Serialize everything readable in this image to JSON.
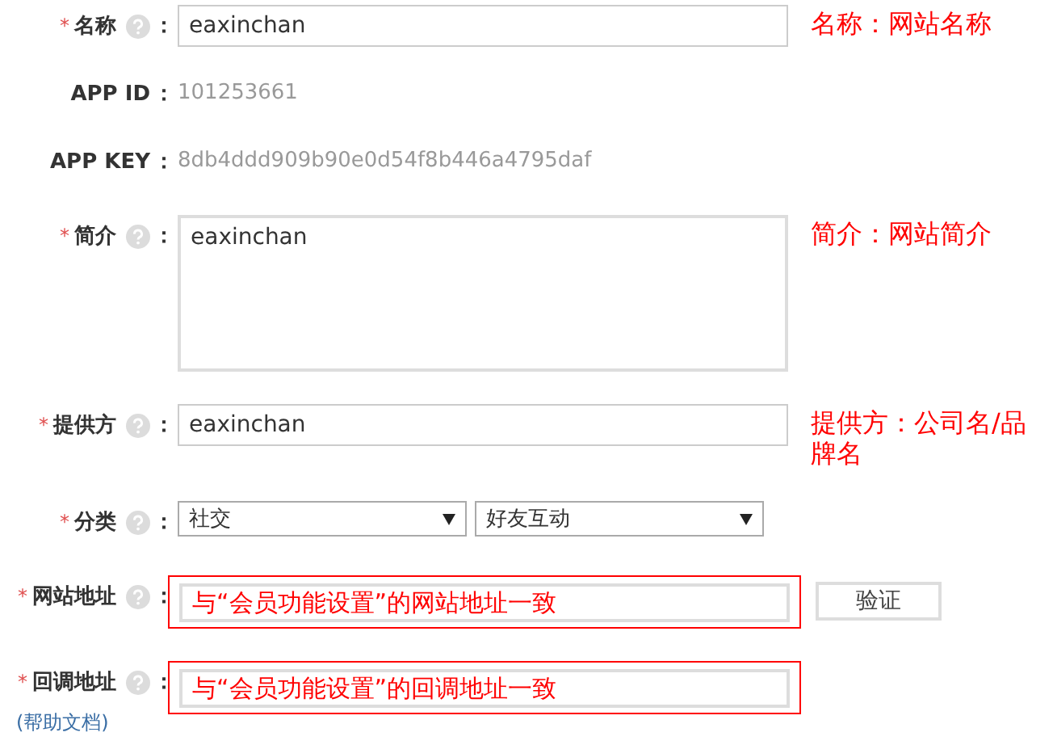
{
  "fields": [
    {
      "kind": "text",
      "mark": "*",
      "label": "名称",
      "help_icon": true,
      "colon": "：",
      "value": "eaxinchan",
      "note": "名称：网站名称"
    },
    {
      "kind": "static",
      "label": "APP ID",
      "colon": "：",
      "value": "101253661"
    },
    {
      "kind": "static",
      "label": "APP KEY",
      "colon": "：",
      "value": "8db4ddd909b90e0d54f8b446a4795daf"
    },
    {
      "kind": "textarea",
      "mark": "*",
      "label": "简介",
      "help_icon": true,
      "colon": "：",
      "value": "eaxinchan",
      "note": "简介：网站简介"
    },
    {
      "kind": "text",
      "mark": "*",
      "label": "提供方",
      "help_icon": true,
      "colon": "：",
      "value": "eaxinchan",
      "note": "提供方：公司名/品牌名"
    },
    {
      "kind": "select",
      "mark": "*",
      "label": "分类",
      "help_icon": true,
      "colon": "：",
      "options": [
        "社交",
        "好友互动"
      ]
    },
    {
      "kind": "url",
      "mark": "*",
      "label": "网站地址",
      "help_icon": true,
      "colon": "：",
      "highlighted": true,
      "value": "与“会员功能设置”的网站地址一致",
      "button": "验证"
    },
    {
      "kind": "url",
      "mark": "*",
      "label": "回调地址",
      "help_icon": true,
      "colon": "：",
      "highlighted": true,
      "value": "与“会员功能设置”的回调地址一致",
      "link": "(帮助文档)"
    }
  ]
}
